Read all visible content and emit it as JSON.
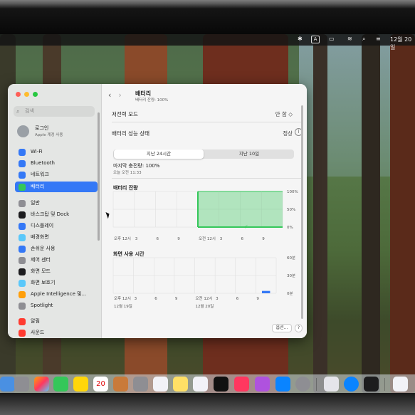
{
  "menubar": {
    "input_indicator": "A",
    "clock": "12월 20일"
  },
  "sidebar": {
    "search_placeholder": "검색",
    "account_name": "로그인",
    "account_sub": "Apple 계정 사용",
    "items": [
      {
        "label": "Wi-Fi",
        "icon": "wifi-icon",
        "color": "#3478f6"
      },
      {
        "label": "Bluetooth",
        "icon": "bluetooth-icon",
        "color": "#3478f6"
      },
      {
        "label": "네트워크",
        "icon": "globe-icon",
        "color": "#3478f6"
      },
      {
        "label": "배터리",
        "icon": "battery-icon",
        "color": "#34c759",
        "active": true
      },
      {
        "label": "일반",
        "icon": "gear-icon",
        "color": "#8e8e93"
      },
      {
        "label": "손쉬운 사용",
        "icon": "accessibility-icon",
        "color": "#3478f6"
      },
      {
        "label": "제어 센터",
        "icon": "control-center-icon",
        "color": "#8e8e93"
      },
      {
        "label": "화면 보호기",
        "icon": "screensaver-icon",
        "color": "#5ac8fa"
      },
      {
        "label": "Apple Intelligence 및...",
        "icon": "apple-intelligence-icon",
        "color": "#ff9f0a"
      },
      {
        "label": "Spotlight",
        "icon": "spotlight-icon",
        "color": "#8e8e93"
      },
      {
        "label": "알림",
        "icon": "notifications-icon",
        "color": "#ff3b30"
      },
      {
        "label": "사운드",
        "icon": "sound-icon",
        "color": "#ff3b30"
      }
    ],
    "items_partial": [
      {
        "label": "바스크탑 및 Dock",
        "icon": "dock-icon",
        "color": "#1c1c1e"
      },
      {
        "label": "디스플레이",
        "icon": "display-icon",
        "color": "#3478f6"
      },
      {
        "label": "배경화면",
        "icon": "wallpaper-icon",
        "color": "#5ac8fa"
      },
      {
        "label": "화면 모드",
        "icon": "appearance-icon",
        "color": "#1c1c1e"
      }
    ]
  },
  "main": {
    "title": "배터리",
    "subtitle": "배터리 잔량: 100%",
    "low_power_label": "저전력 모드",
    "low_power_value": "안 함 ◇",
    "health_label": "배터리 성능 상태",
    "health_value": "정상",
    "tabs": [
      "지난 24시간",
      "지난 10일"
    ],
    "last_charged": "마지막 충전량: 100%",
    "last_charged_time": "오늘 오전 11:33",
    "battery_level_title": "배터리 잔량",
    "screen_time_title": "화면 사용 시간",
    "options_button": "옵션...",
    "help_button": "?"
  },
  "chart_data": [
    {
      "type": "area",
      "title": "배터리 잔량",
      "x": [
        "오후 12시",
        "3",
        "6",
        "9",
        "오전 12시",
        "3",
        "6",
        "9"
      ],
      "y_ticks": [
        "100%",
        "50%",
        "0%"
      ],
      "ylim": [
        0,
        100
      ],
      "series": [
        {
          "values": [
            null,
            null,
            null,
            null,
            100,
            100,
            100,
            100
          ],
          "color": "#34c759"
        }
      ],
      "grid": true
    },
    {
      "type": "bar",
      "title": "화면 사용 시간",
      "x": [
        "오후 12시",
        "3",
        "6",
        "9",
        "오전 12시",
        "3",
        "6",
        "9"
      ],
      "x_dates": [
        "12월 19일",
        "12월 20일"
      ],
      "y_ticks": [
        "60분",
        "30분",
        "0분"
      ],
      "ylim": [
        0,
        60
      ],
      "series": [
        {
          "values": [
            0,
            0,
            0,
            0,
            0,
            0,
            0,
            4
          ],
          "color": "#3478f6"
        }
      ],
      "grid": true
    }
  ],
  "dock": {
    "calendar_day": "20",
    "items": [
      "finder",
      "launchpad",
      "photos",
      "facetime",
      "notes",
      "calendar",
      "archive",
      "screenshot",
      "reminders",
      "stickies",
      "freeform",
      "appletv",
      "music",
      "podcasts",
      "appstore",
      "settings",
      "preview",
      "bluetooth",
      "activity",
      "document"
    ]
  },
  "colors": {
    "accent": "#3478f6",
    "battery_green": "#34c759"
  }
}
